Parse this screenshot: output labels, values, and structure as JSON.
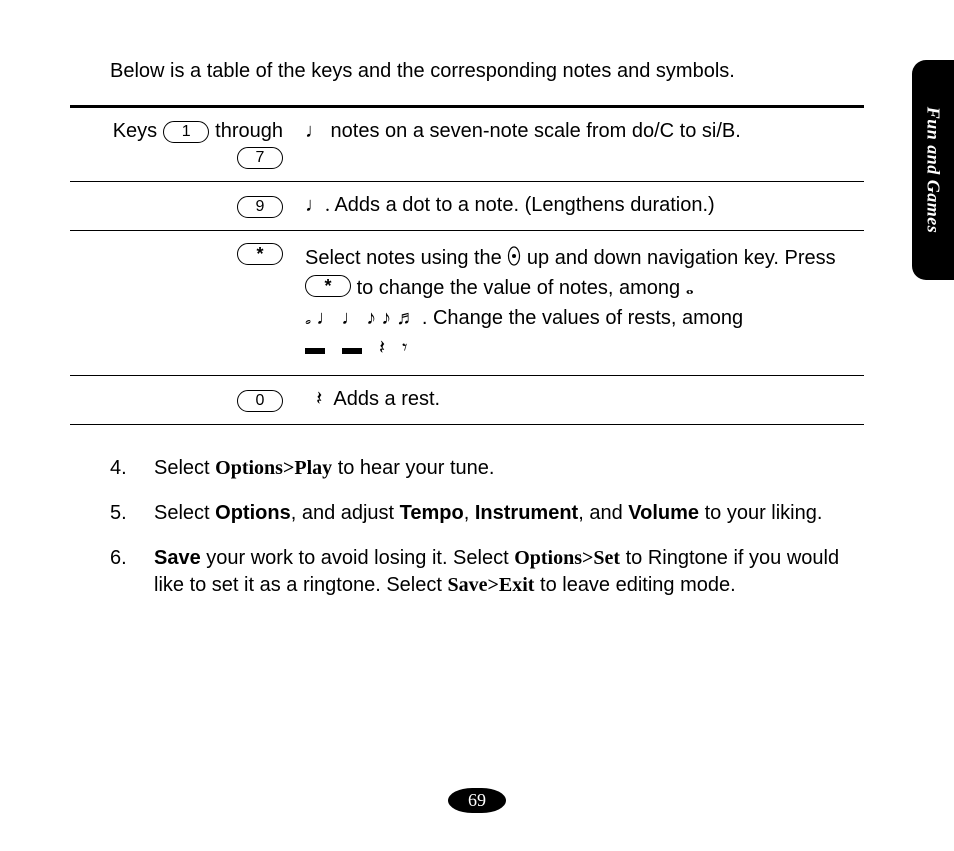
{
  "sidetab": "Fun and Games",
  "intro": "Below is a table of the keys and the corresponding notes and symbols.",
  "table": {
    "rows": [
      {
        "keys_prefix": "Keys",
        "keys_mid": "through",
        "k1": "1",
        "k2": "7",
        "desc": " notes on a seven-note scale from do/C to si/B.",
        "glyph": "♩"
      },
      {
        "k1": "9",
        "glyph": "♩.",
        "desc": " Adds a dot to a note. (Lengthens duration.)"
      },
      {
        "k1": "*",
        "d1": "Select notes using the ",
        "d2": " up and down navigation key. Press ",
        "d3": " to change the value of notes, among ",
        "notes_run": "𝅗 ♩ ♩ ♪ ♪ ♬",
        "d4": ". Change the values of rests, among",
        "rests_run": "▬  ▬  𝄽  𝄾",
        "star": "*",
        "whole": "𝅝"
      },
      {
        "k1": "0",
        "glyph": "𝄽",
        "desc": "Adds a rest."
      }
    ]
  },
  "steps": [
    {
      "n": "4.",
      "a": "Select ",
      "m1": "Options>Play",
      "b": " to hear your tune."
    },
    {
      "n": "5.",
      "a": "Select ",
      "b1": "Options",
      "c": ", and adjust ",
      "b2": "Tempo",
      "d": ", ",
      "b3": "Instrument",
      "e": ", and ",
      "b4": "Volume",
      "f": " to your liking."
    },
    {
      "n": "6.",
      "b1": "Save",
      "a": " your work to avoid losing it. Select ",
      "m1": "Options>Set",
      "b": " to Ringtone if you would like to set it as a ringtone. Select ",
      "m2": "Save>Exit",
      "c": " to leave editing mode."
    }
  ],
  "page_number": "69"
}
